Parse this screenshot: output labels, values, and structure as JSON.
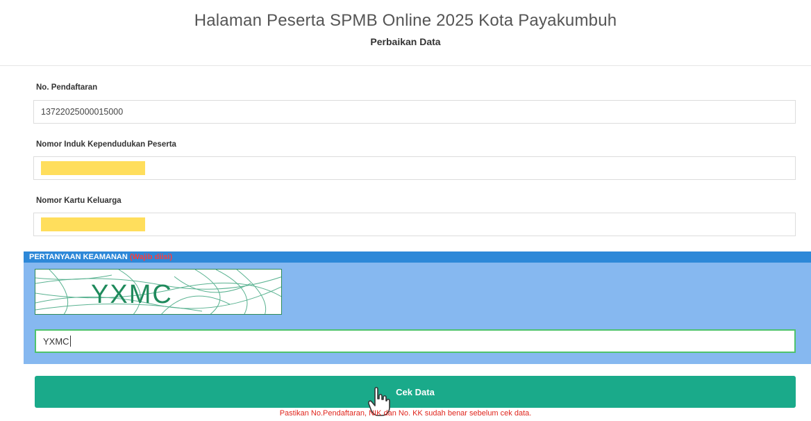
{
  "header": {
    "title": "Halaman Peserta SPMB Online 2025 Kota Payakumbuh",
    "subtitle": "Perbaikan Data"
  },
  "form": {
    "registration": {
      "label": "No. Pendaftaran",
      "value": "13722025000015000"
    },
    "nik": {
      "label": "Nomor Induk Kependudukan Peserta",
      "value": ""
    },
    "kk": {
      "label": "Nomor Kartu Keluarga",
      "value": ""
    }
  },
  "security": {
    "title": "PERTANYAAN KEAMANAN",
    "required_note": "(Wajib diisi)",
    "captcha_text": "YXMC",
    "input_value": "YXMC"
  },
  "button": {
    "label": "Cek Data"
  },
  "note": "Pastikan No.Pendaftaran, NIK dan No. KK sudah benar sebelum cek data.",
  "colors": {
    "masked_fill": "#ffde5c",
    "security_bg": "#86b8f0",
    "security_header": "#2d88d8",
    "button": "#1aaa8a",
    "warning": "#e0251c"
  }
}
